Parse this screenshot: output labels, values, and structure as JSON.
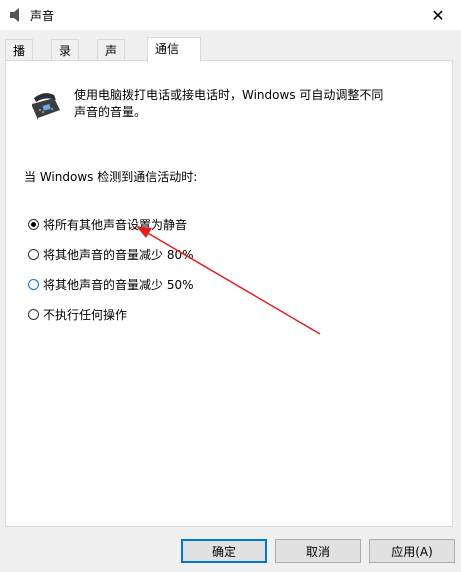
{
  "window": {
    "title": "声音",
    "close_glyph": "✕"
  },
  "tabs": [
    {
      "label": "播放"
    },
    {
      "label": "录制"
    },
    {
      "label": "声音"
    },
    {
      "label": "通信"
    }
  ],
  "active_tab": "通信",
  "panel": {
    "description_line1": "使用电脑拨打电话或接电话时，Windows 可自动调整不同",
    "description_line2": "声音的音量。",
    "section_label": "当 Windows 检测到通信活动时:",
    "options": [
      {
        "label": "将所有其他声音设置为静音",
        "checked": true
      },
      {
        "label": "将其他声音的音量减少 80%",
        "checked": false
      },
      {
        "label": "将其他声音的音量减少 50%",
        "checked": false
      },
      {
        "label": "不执行任何操作",
        "checked": false
      }
    ]
  },
  "buttons": {
    "ok": "确定",
    "cancel": "取消",
    "apply": "应用(A)"
  },
  "colors": {
    "accent": "#0078d7",
    "annotation_arrow": "#e02020"
  }
}
